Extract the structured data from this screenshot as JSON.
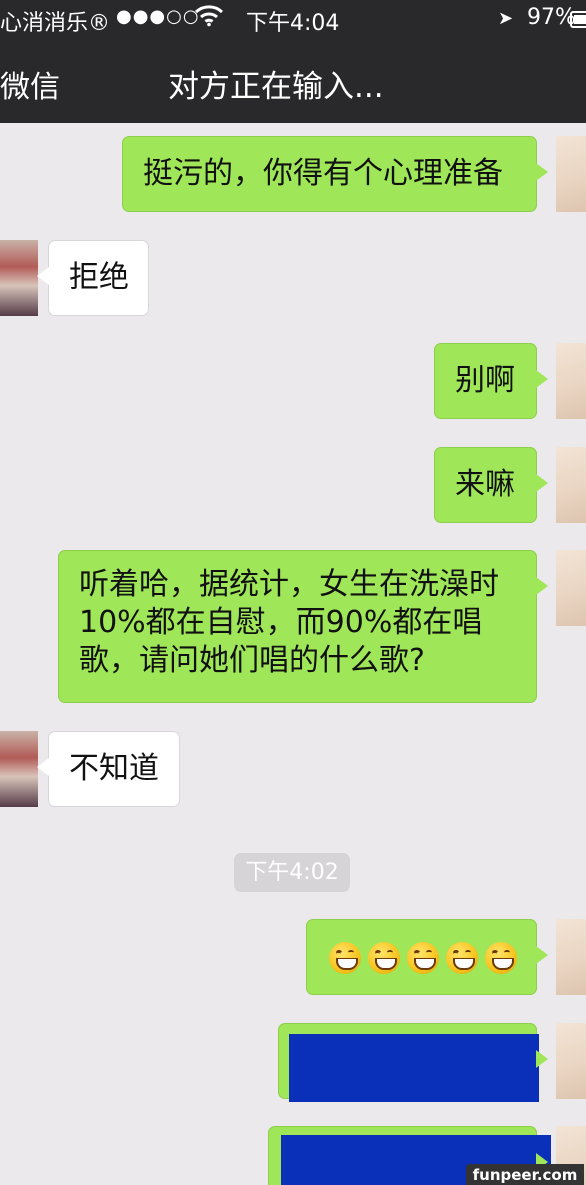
{
  "status_bar": {
    "carrier": "心消消乐®",
    "signal": "●●●○○",
    "wifi_icon": "wifi-icon",
    "time": "下午4:04",
    "location_icon": "location-arrow-icon",
    "battery": "97%"
  },
  "nav": {
    "back_label": "微信",
    "title": "对方正在输入..."
  },
  "messages": [
    {
      "side": "me",
      "text": "挺污的，你得有个心理准备"
    },
    {
      "side": "other",
      "text": "拒绝"
    },
    {
      "side": "me",
      "text": "别啊"
    },
    {
      "side": "me",
      "text": "来嘛"
    },
    {
      "side": "me",
      "text": "听着哈，据统计，女生在洗澡时10%都在自慰，而90%都在唱歌，请问她们唱的什么歌?"
    },
    {
      "side": "other",
      "text": "不知道"
    },
    {
      "type": "timestamp",
      "text": "下午4:02"
    },
    {
      "side": "me",
      "emoji": "grinning-face",
      "count": 5
    },
    {
      "side": "me",
      "content": "redacted"
    },
    {
      "side": "me",
      "content": "redacted"
    }
  ],
  "watermark": "funpeer.com",
  "colors": {
    "header_bg": "#29292b",
    "chat_bg": "#ebe9ec",
    "my_bubble": "#9fe658",
    "other_bubble": "#ffffff",
    "redaction": "#0a2fb8"
  }
}
